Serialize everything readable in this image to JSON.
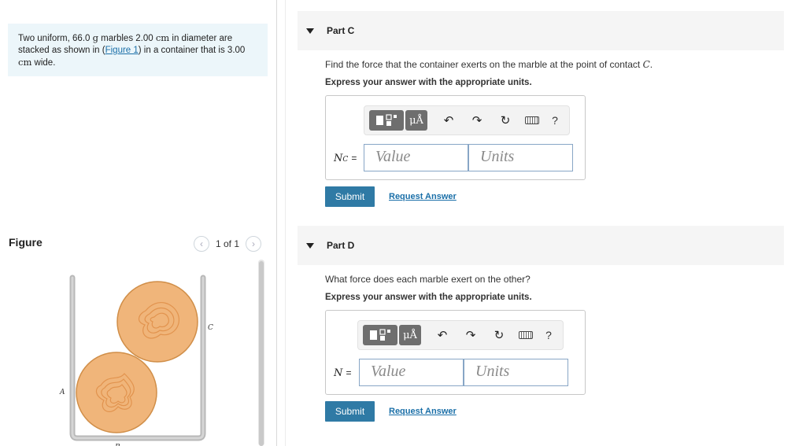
{
  "problem": {
    "text_1": "Two uniform, 66.0 ",
    "unit_g": "g",
    "text_2": " marbles 2.00 ",
    "unit_cm1": "cm",
    "text_3": " in diameter are stacked as shown in (",
    "figure_link": "Figure 1",
    "text_4": ") in a container that is 3.00 ",
    "unit_cm2": "cm",
    "text_5": " wide."
  },
  "figure": {
    "label": "Figure",
    "pager_text": "1 of 1",
    "prev_icon": "chevron-left-icon",
    "next_icon": "chevron-right-icon",
    "point_labels": {
      "a": "A",
      "b": "B",
      "c": "C"
    },
    "marble_color": "#f0b57a",
    "container_color": "#b8b8b8"
  },
  "parts": [
    {
      "title": "Part C",
      "question_prefix": "Find the force that the container exerts on the marble at the point of contact ",
      "question_var": "C",
      "question_suffix": ".",
      "instruction": "Express your answer with the appropriate units.",
      "var_main": "N",
      "var_sub": "C",
      "equals": "=",
      "value_placeholder": "Value",
      "units_placeholder": "Units",
      "submit_label": "Submit",
      "request_label": "Request Answer"
    },
    {
      "title": "Part D",
      "question_prefix": "What force does each marble exert on the other?",
      "question_var": "",
      "question_suffix": "",
      "instruction": "Express your answer with the appropriate units.",
      "var_main": "N",
      "var_sub": "",
      "equals": "=",
      "value_placeholder": "Value",
      "units_placeholder": "Units",
      "submit_label": "Submit",
      "request_label": "Request Answer"
    }
  ],
  "toolbar": {
    "mu_label": "μÅ",
    "undo_icon": "↶",
    "redo_icon": "↷",
    "reset_icon": "↻",
    "help_label": "?",
    "icons": [
      "templates-icon",
      "units-icon",
      "undo-icon",
      "redo-icon",
      "reset-icon",
      "keyboard-icon",
      "help-icon"
    ]
  },
  "colors": {
    "accent": "#2f7aa5",
    "link": "#1a6fa8",
    "problem_bg": "#ecf6fa",
    "header_bg": "#f5f5f5"
  }
}
